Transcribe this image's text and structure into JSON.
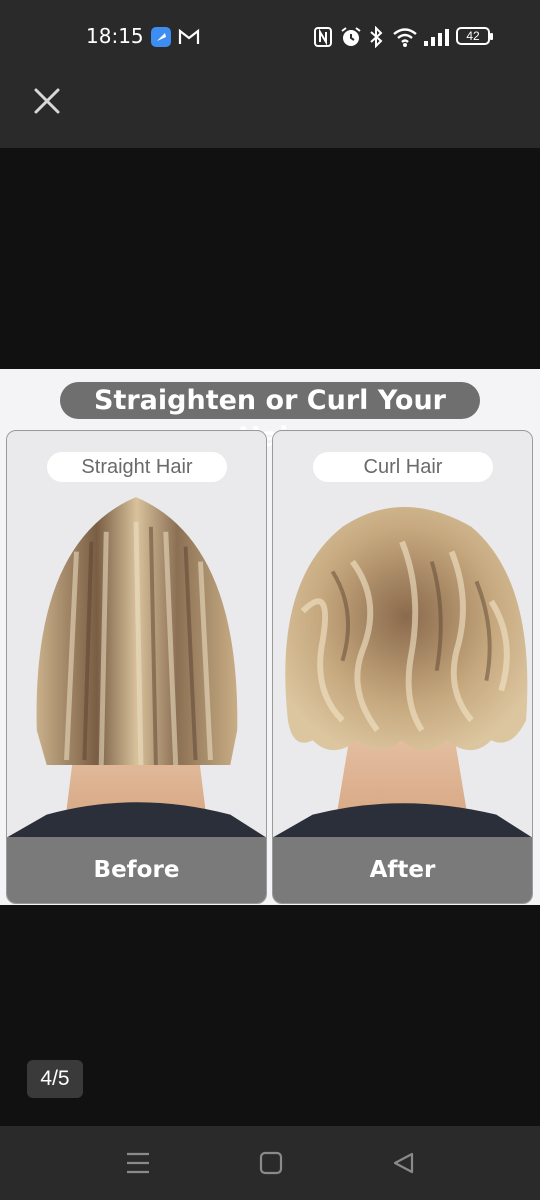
{
  "status_bar": {
    "time": "18:15",
    "notification_icons": [
      "app-icon",
      "gmail-icon"
    ],
    "system_icons": [
      "nfc-icon",
      "alarm-icon",
      "bluetooth-icon",
      "wifi-icon",
      "signal-icon"
    ],
    "battery_level": "42"
  },
  "viewer": {
    "close_icon": "close-icon",
    "page_counter": "4/5"
  },
  "product_image": {
    "title": "Straighten or Curl Your Hair",
    "panels": [
      {
        "label": "Straight Hair",
        "caption": "Before"
      },
      {
        "label": "Curl Hair",
        "caption": "After"
      }
    ]
  },
  "nav_bar": {
    "icons": [
      "menu-icon",
      "home-icon",
      "back-icon"
    ]
  },
  "colors": {
    "status_bar_bg": "#2a2a2a",
    "viewer_bg": "#111111",
    "title_pill": "#6f6f6f",
    "footer_gray": "#7a7a7a"
  }
}
